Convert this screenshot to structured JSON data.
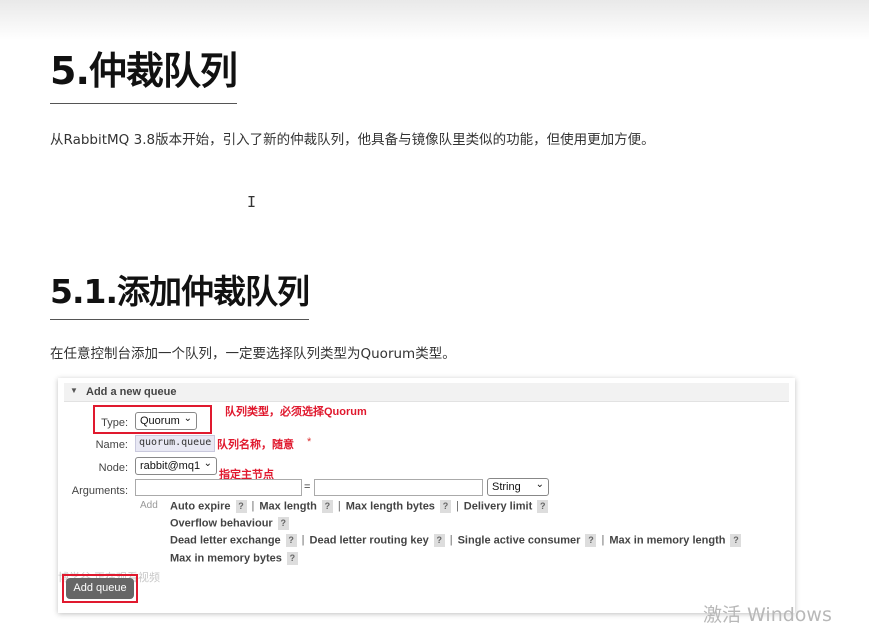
{
  "doc": {
    "heading1": "5.仲裁队列",
    "para1": "从RabbitMQ 3.8版本开始，引入了新的仲裁队列，他具备与镜像队里类似的功能，但使用更加方便。",
    "heading2": "5.1.添加仲裁队列",
    "para2": "在任意控制台添加一个队列，一定要选择队列类型为Quorum类型。"
  },
  "cursor_glyph": "I",
  "panel": {
    "title": "Add a new queue",
    "type_label": "Type:",
    "type_value": "Quorum",
    "name_label": "Name:",
    "name_value": "quorum.queue",
    "required_mark": "*",
    "node_label": "Node:",
    "node_value": "rabbit@mq1",
    "arguments_label": "Arguments:",
    "equals": "=",
    "arg_type_value": "String",
    "add_link": "Add",
    "options": {
      "auto_expire": "Auto expire",
      "max_length": "Max length",
      "max_length_bytes": "Max length bytes",
      "delivery_limit": "Delivery limit",
      "overflow_behaviour": "Overflow behaviour",
      "dead_letter_exchange": "Dead letter exchange",
      "dead_letter_routing_key": "Dead letter routing key",
      "single_active_consumer": "Single active consumer",
      "max_in_memory_length": "Max in memory length",
      "max_in_memory_bytes": "Max in memory bytes"
    },
    "help_mark": "?",
    "separator": "|",
    "add_queue_button": "Add queue",
    "watermark": "博学谷 正在观看视频"
  },
  "annotations": {
    "type_note": "队列类型，必须选择Quorum",
    "name_note": "队列名称，随意",
    "node_note": "指定主节点"
  },
  "os_watermark": "激活 Windows",
  "colors": {
    "annotation_red": "#e0192e",
    "button_grey": "#666666"
  }
}
